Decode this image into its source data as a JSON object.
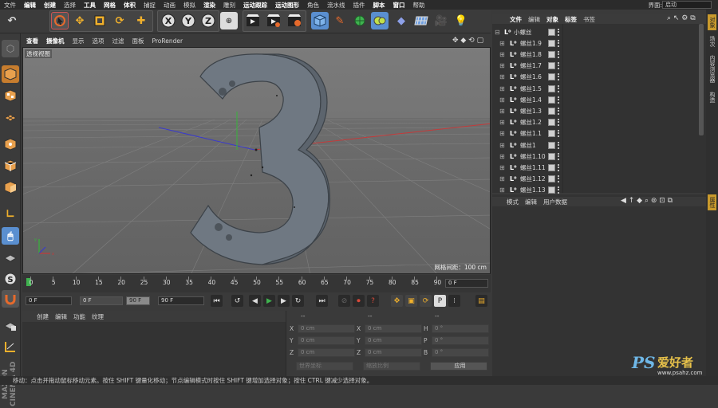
{
  "menubar": {
    "items": [
      "文件",
      "编辑",
      "创建",
      "选择",
      "工具",
      "网格",
      "体积",
      "捕捉",
      "动画",
      "模拟",
      "渲染",
      "雕刻",
      "运动跟踪",
      "运动图形",
      "角色",
      "流水线",
      "插件",
      "脚本",
      "窗口",
      "帮助"
    ],
    "bold_items": [
      "编辑",
      "创建",
      "工具",
      "网格",
      "体积",
      "渲染",
      "运动跟踪",
      "运动图形",
      "脚本",
      "窗口"
    ],
    "interface_label": "界面:",
    "layout_value": "启动"
  },
  "toolbar": {
    "icons": [
      "undo-icon",
      "live-select-icon",
      "move-icon",
      "scale-icon",
      "rotate-icon",
      "move-axis-icon",
      "x-axis-icon",
      "y-axis-icon",
      "z-axis-icon",
      "coordinate-system-icon",
      "render-view-icon",
      "render-to-picture-viewer-icon",
      "render-settings-icon",
      "cube-icon",
      "pen-icon",
      "subdivision-icon",
      "mograph-icon",
      "deformer-icon",
      "floor-icon",
      "camera-icon",
      "light-icon"
    ],
    "axis_labels": [
      "X",
      "Y",
      "Z"
    ]
  },
  "left_tools": [
    "make-editable-icon",
    "model-mode-icon",
    "texture-mode-icon",
    "workplane-icon",
    "points-icon",
    "edges-icon",
    "polygons-icon",
    "axis-mode-icon",
    "tweak-icon",
    "soft-selection-icon",
    "snapping-icon",
    "magnet-icon",
    "lock-workplane-icon",
    "solo-icon"
  ],
  "viewport": {
    "menu": [
      "查看",
      "摄像机",
      "显示",
      "选项",
      "过滤",
      "面板",
      "ProRender"
    ],
    "bold_menu": [
      "查看",
      "摄像机"
    ],
    "label": "透视视图",
    "grid_spacing": "网格间距：100 cm"
  },
  "timeline": {
    "ticks": [
      "0",
      "5",
      "10",
      "15",
      "20",
      "25",
      "30",
      "35",
      "40",
      "45",
      "50",
      "55",
      "60",
      "65",
      "70",
      "75",
      "80",
      "85",
      "90"
    ],
    "current_frame": "0 F"
  },
  "transport": {
    "start": "0 F",
    "preview_start": "0 F",
    "preview_end": "90 F",
    "end": "90 F"
  },
  "material": {
    "menu": [
      "创建",
      "编辑",
      "功能",
      "纹理"
    ]
  },
  "coordinates": {
    "header_left": "--",
    "header_mid": "--",
    "header_right": "--",
    "rows": [
      {
        "a": "X",
        "av": "0 cm",
        "b": "X",
        "bv": "0 cm",
        "c": "H",
        "cv": "0 °"
      },
      {
        "a": "Y",
        "av": "0 cm",
        "b": "Y",
        "bv": "0 cm",
        "c": "P",
        "cv": "0 °"
      },
      {
        "a": "Z",
        "av": "0 cm",
        "b": "Z",
        "bv": "0 cm",
        "c": "B",
        "cv": "0 °"
      }
    ],
    "world_coord": "世界坐标",
    "scale_ratio": "缩放比例",
    "apply": "应用"
  },
  "object_manager": {
    "menu": [
      "文件",
      "编辑",
      "对象",
      "标签",
      "书签"
    ],
    "bold_menu": [
      "文件",
      "对象",
      "标签"
    ],
    "objects": [
      "小螺丝",
      "螺丝1.9",
      "螺丝1.8",
      "螺丝1.7",
      "螺丝1.6",
      "螺丝1.5",
      "螺丝1.4",
      "螺丝1.3",
      "螺丝1.2",
      "螺丝1.1",
      "螺丝1",
      "螺丝1.10",
      "螺丝1.11",
      "螺丝1.12",
      "螺丝1.13"
    ]
  },
  "attribute_manager": {
    "menu": [
      "模式",
      "编辑",
      "用户数据"
    ]
  },
  "right_tabs": [
    "对象",
    "场次",
    "内容浏览器",
    "构造"
  ],
  "right_tab_bottom": "属性",
  "status": "移动：点击并拖动鼠标移动元素。按住 SHIFT 键量化移动；节点编辑模式时按住 SHIFT 键增加选择对象；按住 CTRL 键减少选择对象。",
  "watermark": {
    "brand": "PS",
    "text": "爱好者",
    "url": "www.psahz.com"
  },
  "colors": {
    "accent": "#c99a2c",
    "active_button": "#4b7db5",
    "play_green": "#3fb34f",
    "record_red": "#d94a3a"
  }
}
